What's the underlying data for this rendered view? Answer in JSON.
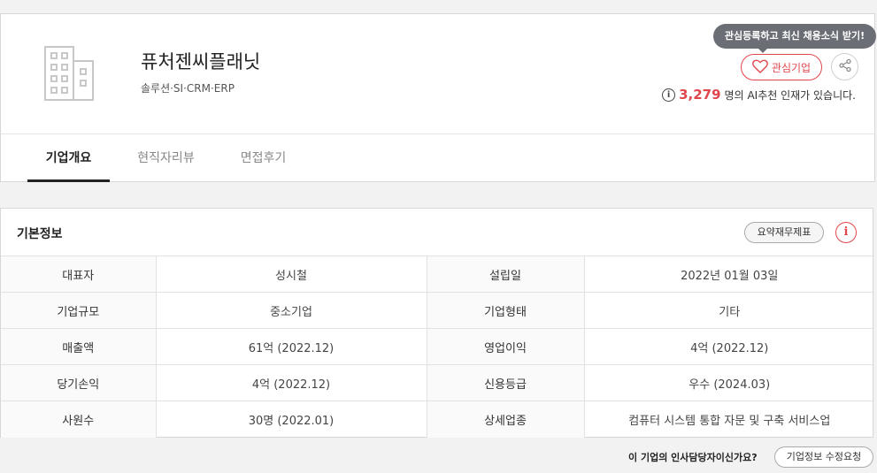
{
  "company": {
    "name": "퓨처젠씨플래닛",
    "category": "솔루션·SI·CRM·ERP",
    "logo_icon": "building-icon"
  },
  "actions": {
    "tooltip": "관심등록하고 최신 채용소식 받기!",
    "favorite_label": "관심기업",
    "favorite_icon": "heart-icon",
    "share_icon": "share-icon"
  },
  "ai": {
    "info_icon": "i",
    "count": "3,279",
    "text": "명의 AI추천 인재가 있습니다."
  },
  "tabs": [
    {
      "label": "기업개요"
    },
    {
      "label": "현직자리뷰"
    },
    {
      "label": "면접후기"
    }
  ],
  "basic_info": {
    "title": "기본정보",
    "summary_button": "요약재무제표",
    "alert_icon": "i",
    "rows": [
      {
        "label1": "대표자",
        "value1": "성시철",
        "label2": "설립일",
        "value2": "2022년 01월 03일"
      },
      {
        "label1": "기업규모",
        "value1": "중소기업",
        "label2": "기업형태",
        "value2": "기타"
      },
      {
        "label1": "매출액",
        "value1": "61억 (2022.12)",
        "label2": "영업이익",
        "value2": "4억 (2022.12)"
      },
      {
        "label1": "당기손익",
        "value1": "4억 (2022.12)",
        "label2": "신용등급",
        "value2": "우수 (2024.03)"
      },
      {
        "label1": "사원수",
        "value1": "30명 (2022.01)",
        "label2": "상세업종",
        "value2": "컴퓨터 시스템 통합 자문 및 구축 서비스업"
      }
    ]
  },
  "footer": {
    "question": "이 기업의 인사담당자이신가요?",
    "edit_button": "기업정보 수정요청"
  },
  "colors": {
    "accent": "#e0474c",
    "tooltip_bg": "#6b6f75"
  }
}
